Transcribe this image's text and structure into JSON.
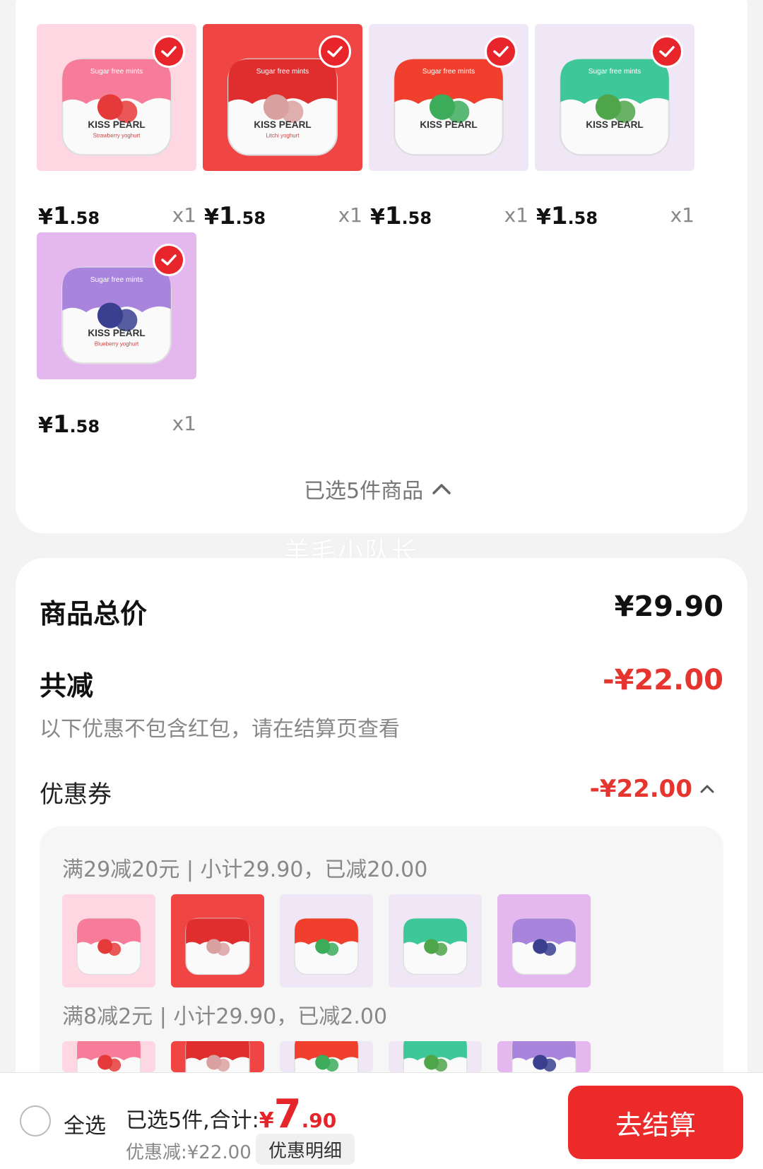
{
  "colors": {
    "accent": "#e5252a",
    "checkout": "#ec2a2a",
    "muted": "#888888"
  },
  "products": [
    {
      "brand": "Sugar free mints",
      "name": "KISS PEARL",
      "flavor": "Strawberry yoghurt",
      "price_yen": "¥",
      "price_int": "1",
      "price_dec": ".58",
      "qty": "x1",
      "bg": "#ffd7e2",
      "lid": "#f77c9a",
      "fruit": "#e53a3a"
    },
    {
      "brand": "Sugar free mints",
      "name": "KISS PEARL",
      "flavor": "Litchi yoghurt",
      "price_yen": "¥",
      "price_int": "1",
      "price_dec": ".58",
      "qty": "x1",
      "bg": "#ef4545",
      "lid": "#e02d2d",
      "fruit": "#d9a0a0"
    },
    {
      "brand": "Sugar free mints",
      "name": "KISS PEARL",
      "flavor": "",
      "price_yen": "¥",
      "price_int": "1",
      "price_dec": ".58",
      "qty": "x1",
      "bg": "#efe7f6",
      "lid": "#f0402d",
      "fruit": "#3cab5a"
    },
    {
      "brand": "Sugar free mints",
      "name": "KISS PEARL",
      "flavor": "",
      "price_yen": "¥",
      "price_int": "1",
      "price_dec": ".58",
      "qty": "x1",
      "bg": "#efe7f6",
      "lid": "#3ec89a",
      "fruit": "#4fa54a"
    },
    {
      "brand": "Sugar free mints",
      "name": "KISS PEARL",
      "flavor": "Blueberry yoghurt",
      "price_yen": "¥",
      "price_int": "1",
      "price_dec": ".58",
      "qty": "x1",
      "bg": "#e4b8ef",
      "lid": "#a884dd",
      "fruit": "#3a3f8f"
    }
  ],
  "selection_toggle": "已选5件商品",
  "watermark": "羊毛小队长",
  "summary": {
    "total_label": "商品总价",
    "total_value": "¥29.90",
    "reduce_label": "共减",
    "reduce_value": "-¥22.00",
    "note": "以下优惠不包含红包，请在结算页查看",
    "coupon_label": "优惠券",
    "coupon_value": "-¥22.00"
  },
  "coupon_rules": [
    "满29减20元 | 小计29.90，已减20.00",
    "满8减2元 | 小计29.90，已减2.00"
  ],
  "bottom": {
    "select_all": "全选",
    "summary_prefix": "已选5件,合计:",
    "currency": "¥",
    "total_int": "7",
    "total_dec": ".90",
    "discount": "优惠减:¥22.00",
    "detail_button": "优惠明细",
    "checkout_button": "去结算"
  }
}
